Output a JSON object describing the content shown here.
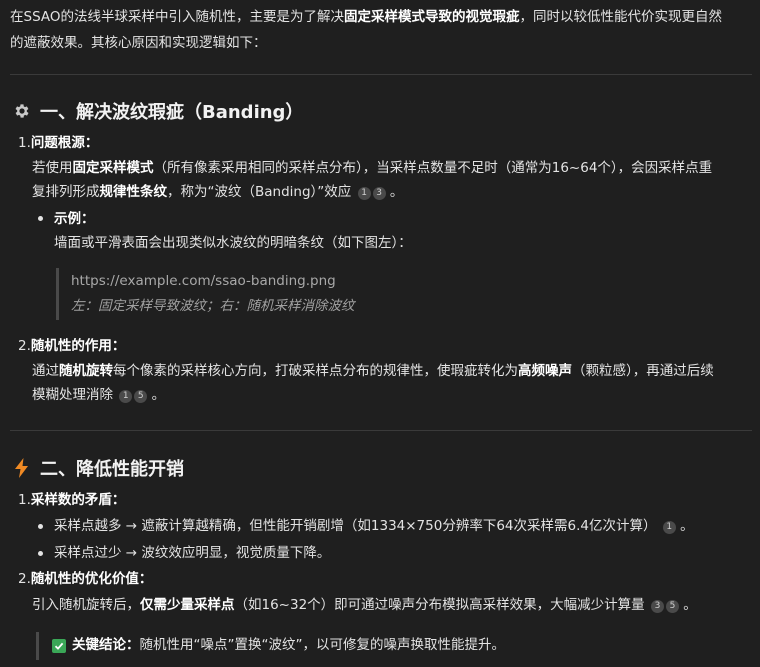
{
  "intro": {
    "p1": "在SSAO的法线半球采样中引入随机性，主要是为了解决",
    "b1": "固定采样模式导致的视觉瑕疵",
    "p2": "，同时以较低性能代价实现更自然",
    "p3": "的遮蔽效果。其核心原因和实现逻辑如下："
  },
  "section1": {
    "icon": "gear-icon",
    "title": "一、解决波纹瑕疵（Banding）",
    "item1_num": "1.",
    "item1_label": "问题根源",
    "item1_colon": "：",
    "item1_l1a": "若使用",
    "item1_l1b": "固定采样模式",
    "item1_l1c": "（所有像素采用相同的采样点分布），当采样点数量不足时（通常为16~64个），会因采样点重",
    "item1_l2a": "复排列形成",
    "item1_l2b": "规律性条纹",
    "item1_l2c": "，称为“波纹（Banding）”效应",
    "item1_cites": [
      "1",
      "3"
    ],
    "period": "。",
    "example_label": "示例",
    "example_colon": "：",
    "example_text": "墙面或平滑表面会出现类似水波纹的明暗条纹（如下图左）：",
    "quote_url": "https://example.com/ssao-banding.png",
    "quote_caption": "左：固定采样导致波纹；右：随机采样消除波纹",
    "item2_num": "2.",
    "item2_label": "随机性的作用",
    "item2_colon": "：",
    "item2_l1a": "通过",
    "item2_l1b": "随机旋转",
    "item2_l1c": "每个像素的采样核心方向，打破采样点分布的规律性，使瑕疵转化为",
    "item2_l1d": "高频噪声",
    "item2_l1e": "（颗粒感），再通过后续",
    "item2_l2": "模糊处理消除",
    "item2_cites": [
      "1",
      "5"
    ]
  },
  "section2": {
    "icon": "lightning-icon",
    "title": "二、降低性能开销",
    "item1_num": "1.",
    "item1_label": "采样数的矛盾",
    "item1_colon": "：",
    "b1": "采样点越多 → 遮蔽计算越精确，但性能开销剧增（如1334×750分辨率下64次采样需6.4亿次计算）",
    "b1_cites": [
      "1"
    ],
    "b2": "采样点过少 → 波纹效应明显，视觉质量下降。",
    "item2_num": "2.",
    "item2_label": "随机性的优化价值",
    "item2_colon": "：",
    "item2_la": "引入随机旋转后，",
    "item2_lb": "仅需少量采样点",
    "item2_lc": "（如16~32个）即可通过噪声分布模拟高采样效果，大幅减少计算量",
    "item2_cites": [
      "3",
      "5"
    ],
    "conclusion_label": "关键结论",
    "conclusion_colon": "：",
    "conclusion_text": "随机性用“噪点”置换“波纹”，以可修复的噪声换取性能提升。"
  },
  "colors": {
    "background": "#1f1f1f",
    "text": "#e3e3e3",
    "accent_check": "#3aa757",
    "accent_bolt": "#f08a24"
  }
}
